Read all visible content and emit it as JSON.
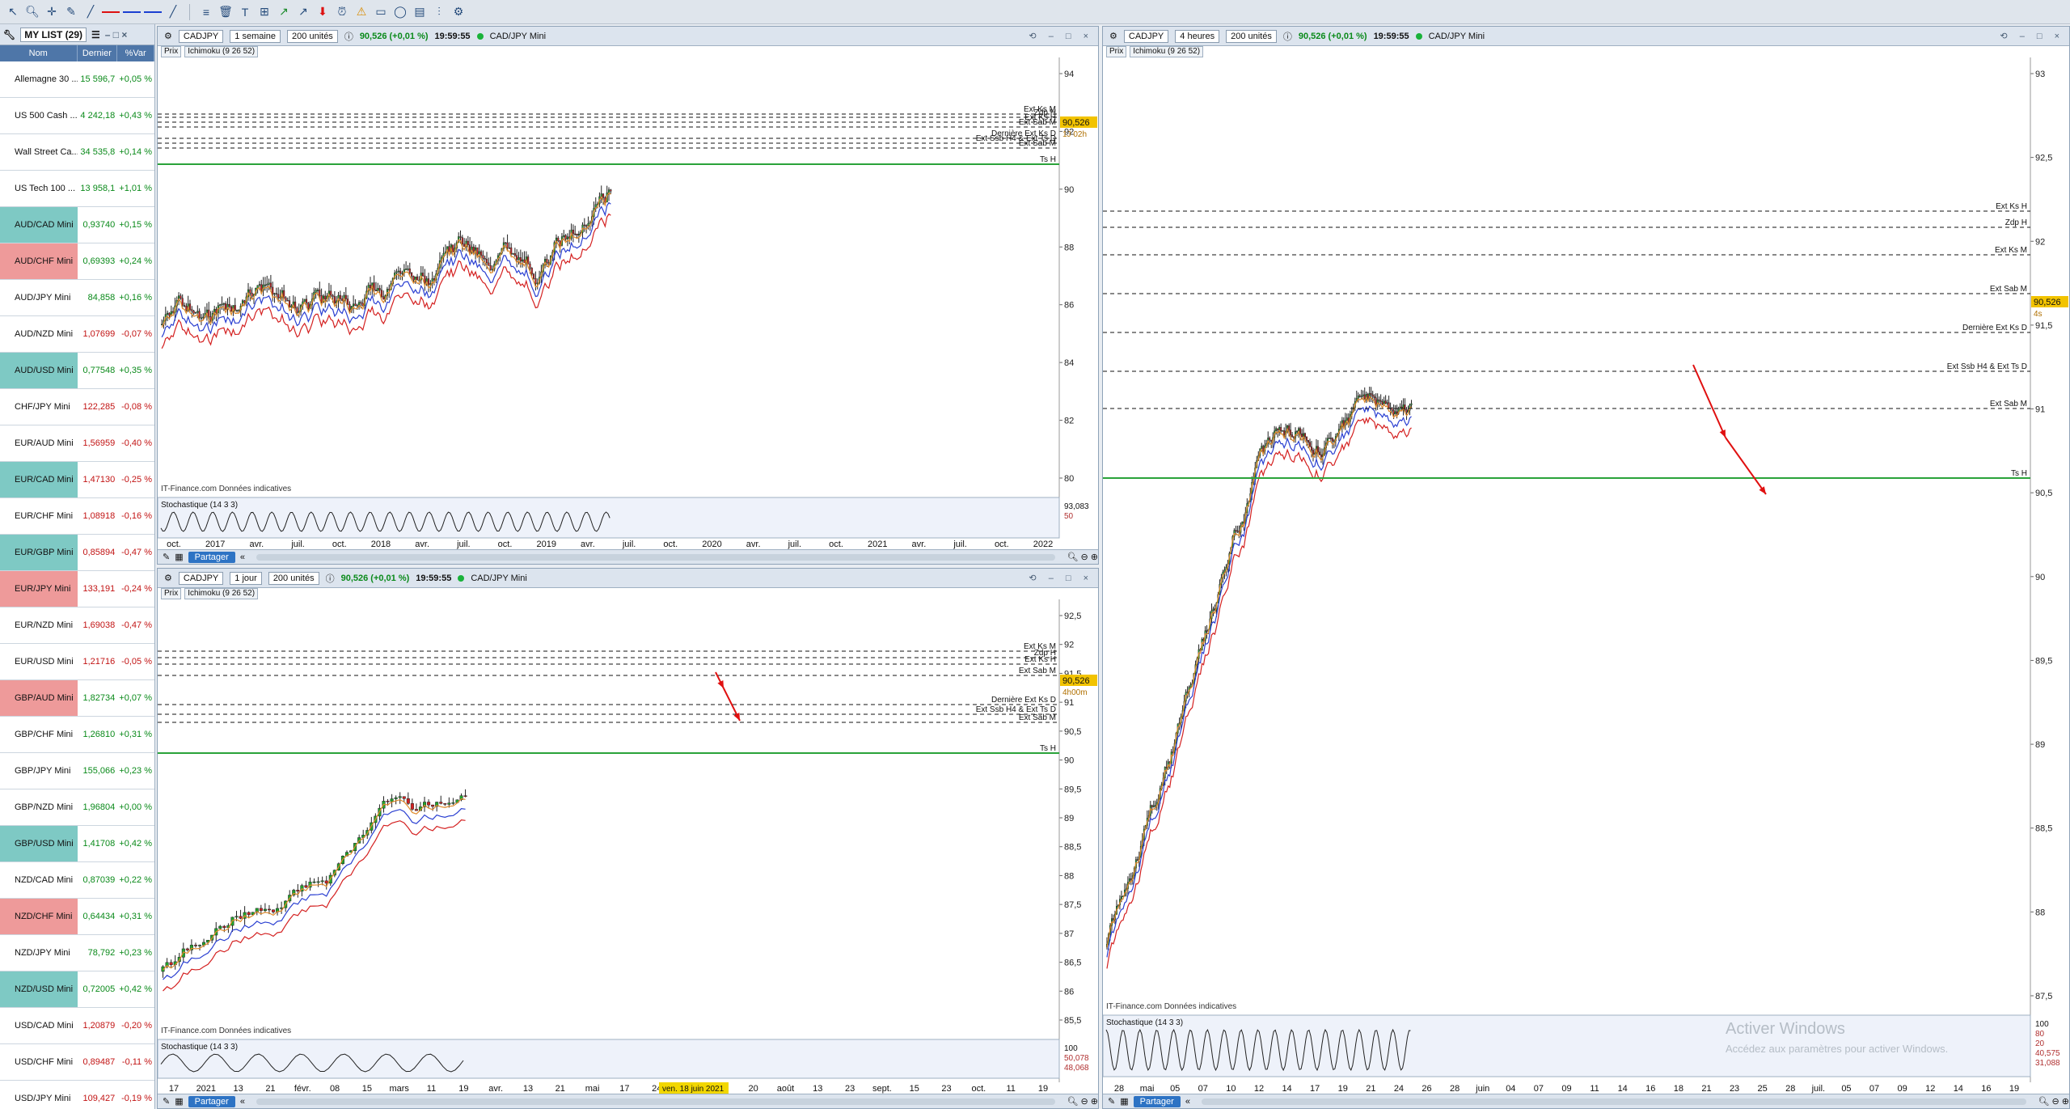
{
  "watchlist": {
    "title": "MY LIST (29)",
    "cols": [
      "Nom",
      "Dernier",
      "%Var"
    ],
    "rows": [
      {
        "name": "Allemagne 30 ...",
        "last": "15 596,7",
        "chg": "+0,05 %",
        "style": "",
        "dir": "pos"
      },
      {
        "name": "US 500 Cash ...",
        "last": "4 242,18",
        "chg": "+0,43 %",
        "style": "",
        "dir": "pos"
      },
      {
        "name": "Wall Street Ca...",
        "last": "34 535,8",
        "chg": "+0,14 %",
        "style": "",
        "dir": "pos"
      },
      {
        "name": "US Tech 100 ...",
        "last": "13 958,1",
        "chg": "+1,01 %",
        "style": "",
        "dir": "pos"
      },
      {
        "name": "AUD/CAD Mini",
        "last": "0,93740",
        "chg": "+0,15 %",
        "style": "teal",
        "dir": "pos"
      },
      {
        "name": "AUD/CHF Mini",
        "last": "0,69393",
        "chg": "+0,24 %",
        "style": "pink",
        "dir": "pos"
      },
      {
        "name": "AUD/JPY Mini",
        "last": "84,858",
        "chg": "+0,16 %",
        "style": "",
        "dir": "pos"
      },
      {
        "name": "AUD/NZD Mini",
        "last": "1,07699",
        "chg": "-0,07 %",
        "style": "",
        "dir": "neg"
      },
      {
        "name": "AUD/USD Mini",
        "last": "0,77548",
        "chg": "+0,35 %",
        "style": "teal",
        "dir": "pos"
      },
      {
        "name": "CHF/JPY Mini",
        "last": "122,285",
        "chg": "-0,08 %",
        "style": "",
        "dir": "neg"
      },
      {
        "name": "EUR/AUD Mini",
        "last": "1,56959",
        "chg": "-0,40 %",
        "style": "",
        "dir": "neg"
      },
      {
        "name": "EUR/CAD Mini",
        "last": "1,47130",
        "chg": "-0,25 %",
        "style": "teal",
        "dir": "neg"
      },
      {
        "name": "EUR/CHF Mini",
        "last": "1,08918",
        "chg": "-0,16 %",
        "style": "",
        "dir": "neg"
      },
      {
        "name": "EUR/GBP Mini",
        "last": "0,85894",
        "chg": "-0,47 %",
        "style": "teal",
        "dir": "neg"
      },
      {
        "name": "EUR/JPY Mini",
        "last": "133,191",
        "chg": "-0,24 %",
        "style": "pink",
        "dir": "neg"
      },
      {
        "name": "EUR/NZD Mini",
        "last": "1,69038",
        "chg": "-0,47 %",
        "style": "",
        "dir": "neg"
      },
      {
        "name": "EUR/USD Mini",
        "last": "1,21716",
        "chg": "-0,05 %",
        "style": "",
        "dir": "neg"
      },
      {
        "name": "GBP/AUD Mini",
        "last": "1,82734",
        "chg": "+0,07 %",
        "style": "pink",
        "dir": "pos"
      },
      {
        "name": "GBP/CHF Mini",
        "last": "1,26810",
        "chg": "+0,31 %",
        "style": "",
        "dir": "pos"
      },
      {
        "name": "GBP/JPY Mini",
        "last": "155,066",
        "chg": "+0,23 %",
        "style": "",
        "dir": "pos"
      },
      {
        "name": "GBP/NZD Mini",
        "last": "1,96804",
        "chg": "+0,00 %",
        "style": "",
        "dir": "pos"
      },
      {
        "name": "GBP/USD Mini",
        "last": "1,41708",
        "chg": "+0,42 %",
        "style": "teal",
        "dir": "pos"
      },
      {
        "name": "NZD/CAD Mini",
        "last": "0,87039",
        "chg": "+0,22 %",
        "style": "",
        "dir": "pos"
      },
      {
        "name": "NZD/CHF Mini",
        "last": "0,64434",
        "chg": "+0,31 %",
        "style": "pink",
        "dir": "pos"
      },
      {
        "name": "NZD/JPY Mini",
        "last": "78,792",
        "chg": "+0,23 %",
        "style": "",
        "dir": "pos"
      },
      {
        "name": "NZD/USD Mini",
        "last": "0,72005",
        "chg": "+0,42 %",
        "style": "teal",
        "dir": "pos"
      },
      {
        "name": "USD/CAD Mini",
        "last": "1,20879",
        "chg": "-0,20 %",
        "style": "",
        "dir": "neg"
      },
      {
        "name": "USD/CHF Mini",
        "last": "0,89487",
        "chg": "-0,11 %",
        "style": "",
        "dir": "neg"
      },
      {
        "name": "USD/JPY Mini",
        "last": "109,427",
        "chg": "-0,19 %",
        "style": "",
        "dir": "neg"
      }
    ]
  },
  "common": {
    "symbol": "CADJPY",
    "units": "200 unités",
    "quote": "90,526 (+0,01 %)",
    "time": "19:59:55",
    "instrument": "CAD/JPY Mini",
    "tab_price": "Prix",
    "tab_ichimoku": "Ichimoku (9 26 52)",
    "stoch": "Stochastique (14 3 3)",
    "source": "IT-Finance.com",
    "source_note": "Données indicatives",
    "share": "Partager",
    "last_price": "90,526"
  },
  "weekly": {
    "period": "1 semaine",
    "countdown": "1J 02h",
    "yticks": [
      "94",
      "92",
      "90",
      "88",
      "86",
      "84",
      "82",
      "80"
    ],
    "xticks": [
      "oct.",
      "2017",
      "avr.",
      "juil.",
      "oct.",
      "2018",
      "avr.",
      "juil.",
      "oct.",
      "2019",
      "avr.",
      "juil.",
      "oct.",
      "2020",
      "avr.",
      "juil.",
      "oct.",
      "2021",
      "avr.",
      "juil.",
      "oct.",
      "2022"
    ],
    "stoch_values": [
      "93,083",
      "50"
    ],
    "levels": [
      "Ext Ks M",
      "Zdp H",
      "Ext Ks H",
      "Ext Sab M",
      "Dernière Ext Ks D",
      "Ext Ssb H4 & Ext Ts D",
      "Ext Sab M",
      "Ts H"
    ]
  },
  "daily": {
    "period": "1 jour",
    "countdown": "4h00m",
    "yticks": [
      "92,5",
      "92",
      "91,5",
      "91",
      "90,5",
      "90",
      "89,5",
      "89",
      "88,5",
      "88",
      "87,5",
      "87",
      "86,5",
      "86",
      "85,5"
    ],
    "xticks": [
      "17",
      "2021",
      "13",
      "21",
      "févr.",
      "08",
      "15",
      "mars",
      "11",
      "19",
      "avr.",
      "13",
      "21",
      "mai",
      "17",
      "24",
      "juin",
      "12",
      "20",
      "août",
      "13",
      "23",
      "sept.",
      "15",
      "23",
      "oct.",
      "11",
      "19"
    ],
    "date_badge": "ven. 18 juin 2021",
    "stoch_values": [
      "100",
      "50,078",
      "48,068"
    ],
    "levels": [
      "Ext Ks M",
      "Zdp H",
      "Ext Ks H",
      "Ext Sab M",
      "Dernière Ext Ks D",
      "Ext Ssb H4 & Ext Ts D",
      "Ext Sab M",
      "Ts H"
    ]
  },
  "h4": {
    "period": "4 heures",
    "countdown": "4s",
    "yticks": [
      "93",
      "92,5",
      "92",
      "91,5",
      "91",
      "90,5",
      "90",
      "89,5",
      "89",
      "88,5",
      "88",
      "87,5"
    ],
    "xticks": [
      "28",
      "mai",
      "05",
      "07",
      "10",
      "12",
      "14",
      "17",
      "19",
      "21",
      "24",
      "26",
      "28",
      "juin",
      "04",
      "07",
      "09",
      "11",
      "14",
      "16",
      "18",
      "21",
      "23",
      "25",
      "28",
      "juil.",
      "05",
      "07",
      "09",
      "12",
      "14",
      "16",
      "19"
    ],
    "stoch_values": [
      "100",
      "80",
      "20",
      "40,575",
      "31,088"
    ],
    "levels": [
      "Ext Ks H",
      "Zdp H",
      "Ext Ks M",
      "Ext Sab M",
      "Dernière Ext Ks D",
      "Ext Ssb H4 & Ext Ts D",
      "Ext Sab M",
      "Ts H"
    ]
  },
  "windows": {
    "activate": "Activer Windows",
    "activate_sub": "Accédez aux paramètres pour activer Windows."
  }
}
